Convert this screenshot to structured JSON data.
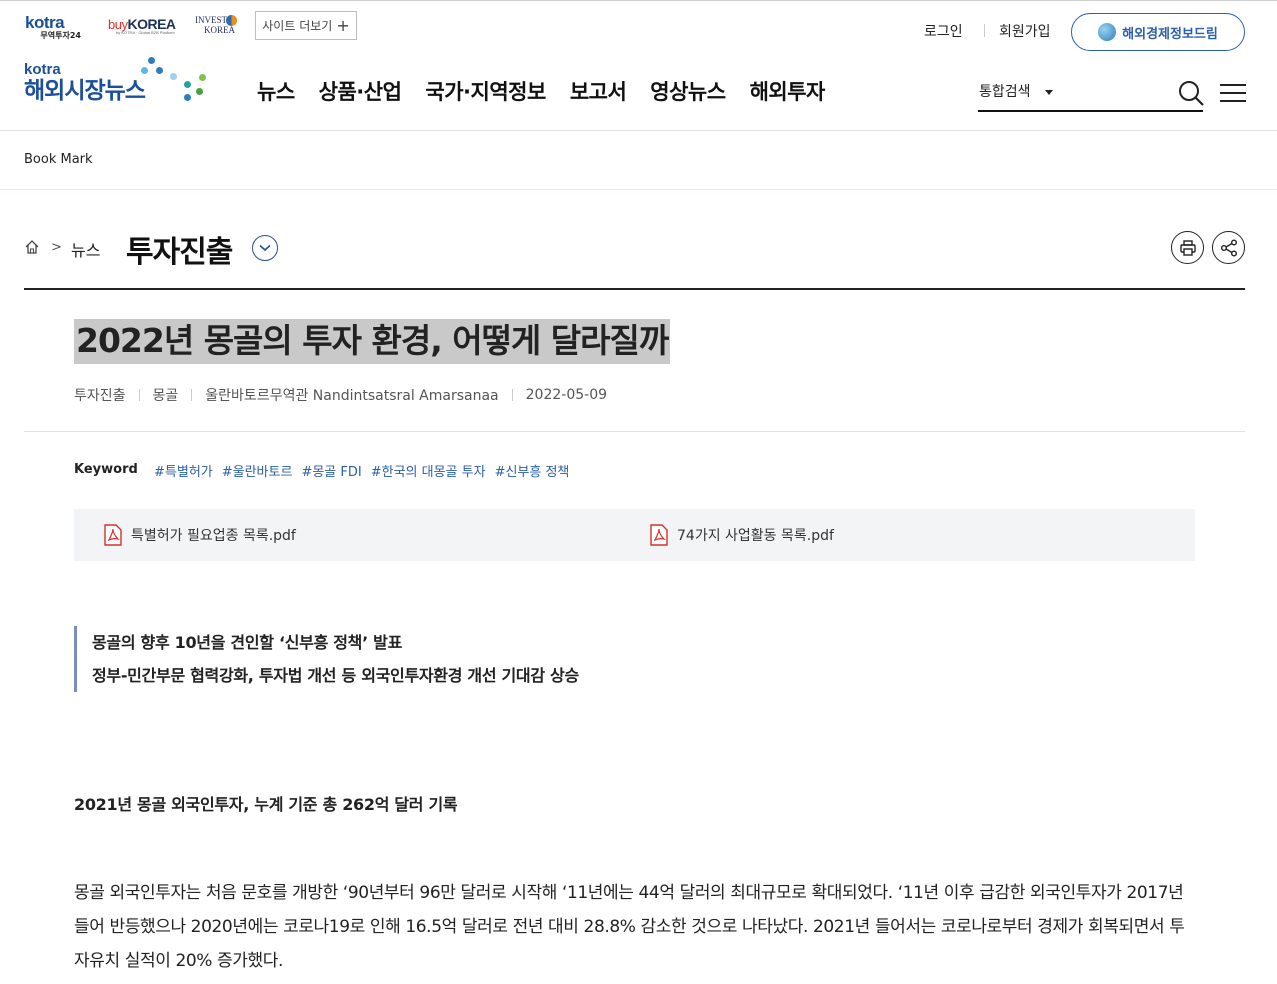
{
  "header": {
    "family_sites": {
      "kotra_logo": "kotra",
      "kotra_sub": "무역투자24",
      "buykorea_buy": "buy",
      "buykorea_korea": "KOREA",
      "buykorea_tag": "by KOTRA · Global B2B Platform",
      "invest_line1": "INVEST",
      "invest_line2": "KOREA",
      "more_label": "사이트 더보기",
      "more_icon": "plus-icon"
    },
    "login_label": "로그인",
    "join_label": "회원가입",
    "dream_label": "해외경제정보드림",
    "logo": {
      "brand": "kotra",
      "title": "해외시장뉴스"
    },
    "nav": [
      "뉴스",
      "상품·산업",
      "국가·지역정보",
      "보고서",
      "영상뉴스",
      "해외투자"
    ],
    "search": {
      "scope": "통합검색",
      "placeholder": ""
    }
  },
  "bookmark_label": "Book Mark",
  "breadcrumb": {
    "home_icon": "home-icon",
    "parent": "뉴스",
    "current": "투자진출"
  },
  "article": {
    "title": "2022년 몽골의 투자 환경, 어떻게 달라질까",
    "meta": {
      "category": "투자진출",
      "country": "몽골",
      "author": "울란바토르무역관 Nandintsatsral Amarsanaa",
      "date": "2022-05-09"
    },
    "keyword_label": "Keyword",
    "keywords": [
      "#특별허가",
      "#울란바토르",
      "#몽골 FDI",
      "#한국의 대몽골 투자",
      "#신부흥 정책"
    ],
    "files": [
      "특별허가 필요업종 목록.pdf",
      "74가지 사업활동 목록.pdf"
    ],
    "summary": [
      "몽골의 향후 10년을 견인할 ‘신부흥 정책’ 발표",
      "정부-민간부문 협력강화, 투자법 개선 등 외국인투자환경 개선 기대감 상승"
    ],
    "section_heading": "2021년 몽골 외국인투자, 누계 기준 총 262억 달러 기록",
    "body": "몽골 외국인투자는 처음 문호를 개방한 ‘90년부터 96만 달러로 시작해 ‘11년에는 44억 달러의 최대규모로 확대되었다. ‘11년 이후 급감한 외국인투자가 2017년 들어 반등했으나 2020년에는 코로나19로 인해 16.5억 달러로 전년 대비 28.8% 감소한 것으로 나타났다. 2021년 들어서는 코로나로부터 경제가 회복되면서 투자유치 실적이 20% 증가했다."
  }
}
